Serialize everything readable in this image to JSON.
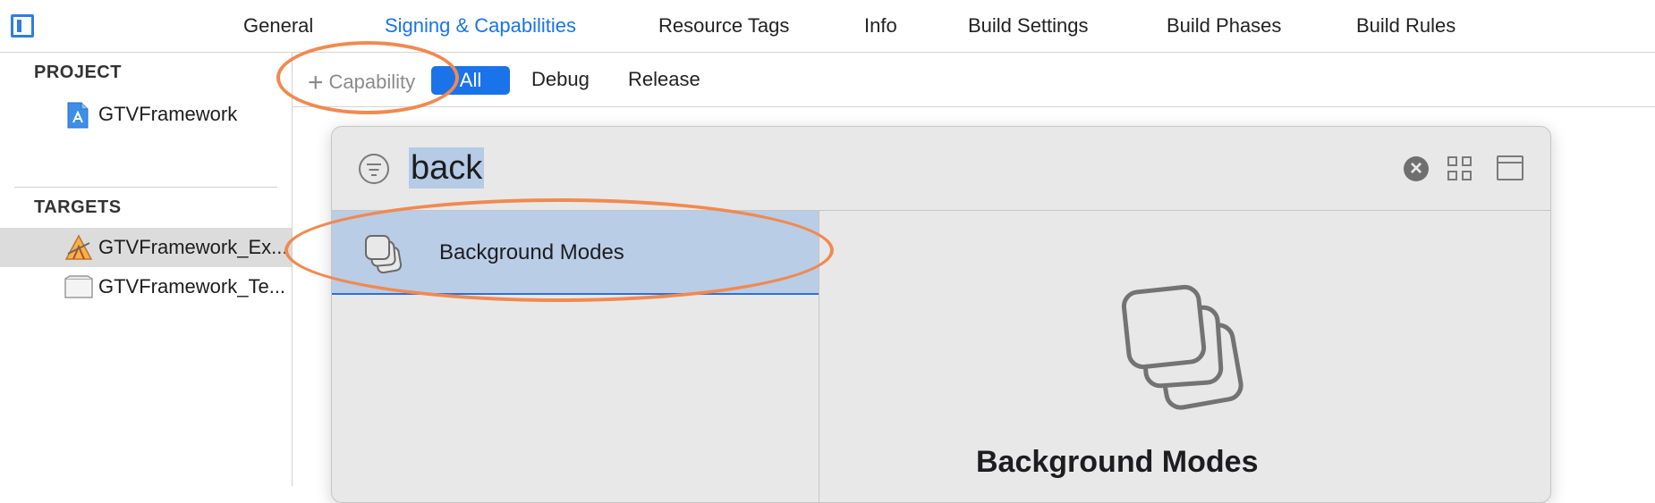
{
  "tabs": [
    {
      "label": "General",
      "active": false
    },
    {
      "label": "Signing & Capabilities",
      "active": true
    },
    {
      "label": "Resource Tags",
      "active": false
    },
    {
      "label": "Info",
      "active": false
    },
    {
      "label": "Build Settings",
      "active": false
    },
    {
      "label": "Build Phases",
      "active": false
    },
    {
      "label": "Build Rules",
      "active": false
    }
  ],
  "sidebar": {
    "project_header": "PROJECT",
    "project_item": "GTVFramework",
    "targets_header": "TARGETS",
    "targets": [
      {
        "label": "GTVFramework_Ex...",
        "selected": true
      },
      {
        "label": "GTVFramework_Te...",
        "selected": false
      }
    ]
  },
  "config_bar": {
    "add_capability_label": "Capability",
    "filters": [
      "All",
      "Debug",
      "Release"
    ],
    "selected_filter": "All"
  },
  "capability_library": {
    "search_value": "back",
    "results": [
      {
        "label": "Background Modes",
        "selected": true
      }
    ],
    "detail_title": "Background Modes"
  },
  "colors": {
    "accent": "#1a73e8",
    "selection": "#b9cde6",
    "annotation": "#f08a50"
  }
}
